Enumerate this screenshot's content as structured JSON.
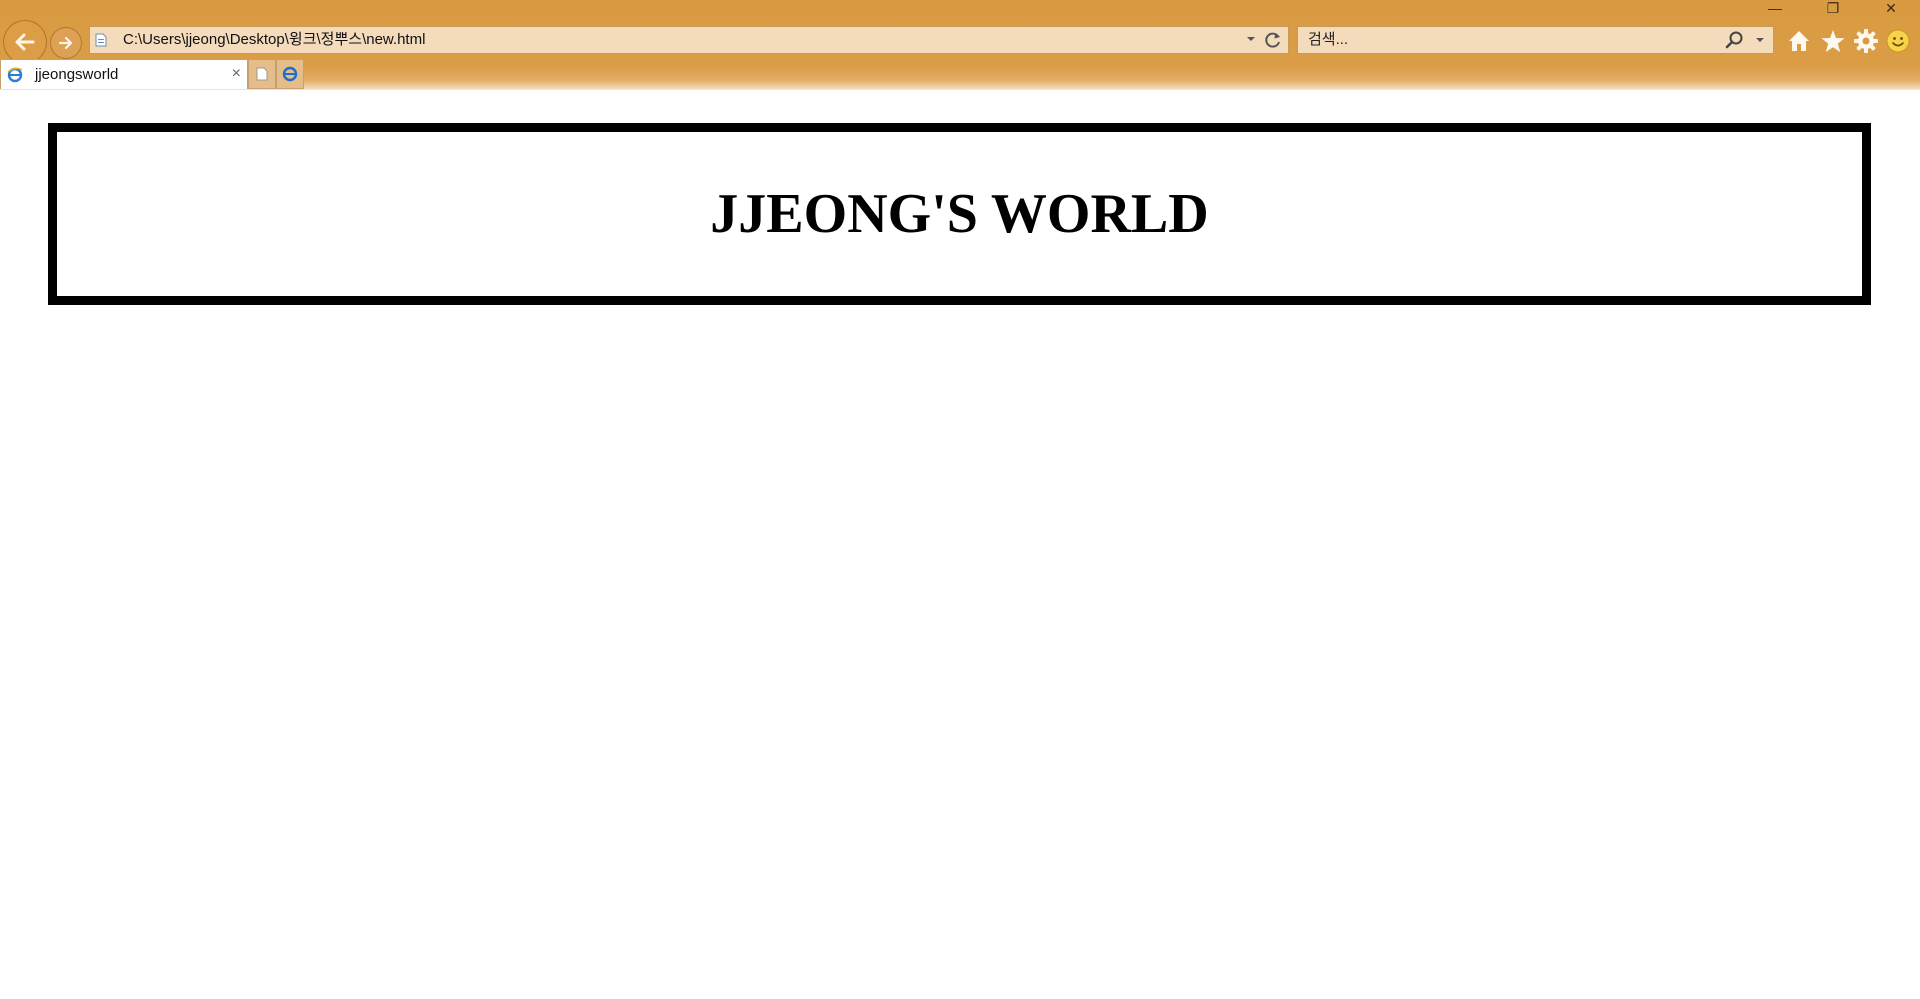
{
  "browser": {
    "address_url": "C:\\Users\\jjeong\\Desktop\\윙크\\정뿌스\\new.html",
    "search_placeholder": "검색...",
    "tab_title": "jjeongsworld",
    "window_controls": {
      "minimize": "—",
      "restore": "❐",
      "close": "✕"
    },
    "tab_close": "×",
    "icons": [
      "back-arrow-icon",
      "forward-arrow-icon",
      "page-icon",
      "dropdown-icon",
      "refresh-icon",
      "search-icon",
      "home-icon",
      "star-icon",
      "gear-icon",
      "smiley-icon",
      "ie-icon",
      "new-tab-icon"
    ],
    "colors": {
      "chrome": "#d99b42",
      "field": "#f3dbbc"
    }
  },
  "page": {
    "heading": "JJEONG'S WORLD"
  }
}
